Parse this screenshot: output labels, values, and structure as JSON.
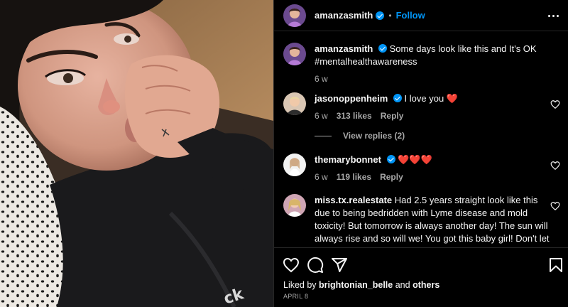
{
  "post": {
    "username": "amanzasmith",
    "separator": "•",
    "follow_label": "Follow",
    "caption": "Some days look like this and It's OK #mentalhealthawareness",
    "caption_age": "6 w"
  },
  "comments": [
    {
      "username": "jasonoppenheim",
      "verified": true,
      "text": "I love you",
      "emoji": "❤️",
      "age": "6 w",
      "likes": "313 likes",
      "reply_label": "Reply",
      "view_replies": "View replies (2)"
    },
    {
      "username": "themarybonnet",
      "verified": true,
      "text": "",
      "emoji": "❤️❤️❤️",
      "age": "6 w",
      "likes": "119 likes",
      "reply_label": "Reply"
    },
    {
      "username": "miss.tx.realestate",
      "verified": false,
      "text": "Had 2.5 years straight look like this due to being bedridden with Lyme disease and mold toxicity! But tomorrow is always another day! The sun will always rise and so will we! You got this baby girl! Don't let stress steal your joy! Focus on the good in your life and feel overwhelming grateful"
    }
  ],
  "footer": {
    "liked_by_prefix": "Liked by",
    "liked_by_user": "brightonian_belle",
    "liked_by_join": "and",
    "liked_by_others": "others",
    "date": "APRIL 8"
  },
  "icons": {
    "more": "more-options-icon",
    "like": "heart-icon",
    "comment": "comment-icon",
    "share": "share-icon",
    "save": "bookmark-icon",
    "verified": "verified-badge-icon"
  },
  "colors": {
    "accent": "#0095f6",
    "heart": "#ff3040",
    "secondary_text": "#a8a8a8",
    "divider": "#262626"
  }
}
